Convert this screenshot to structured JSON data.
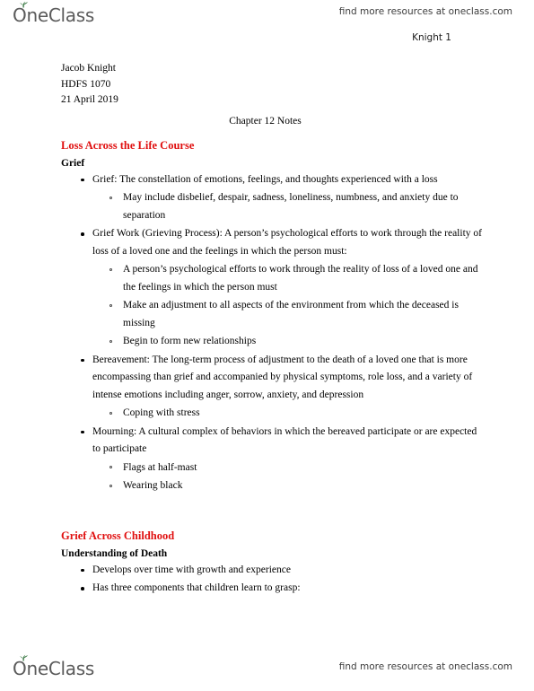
{
  "branding": {
    "logo_text": "OneClass",
    "logo_leaf_icon": "leaf-icon",
    "leaf_color": "#3c7a46",
    "logo_color": "#5b5b5b",
    "watermark": "find more resources at oneclass.com"
  },
  "document": {
    "page_number": "Knight 1",
    "accent_color": "#e01010",
    "meta": [
      "Jacob Knight",
      "HDFS 1070",
      "21 April 2019"
    ],
    "title": "Chapter 12 Notes",
    "sections": [
      {
        "heading": "Loss Across the Life Course",
        "subheading": "Grief",
        "items": [
          {
            "level": 1,
            "text": "Grief: The constellation of emotions, feelings, and thoughts experienced with a loss"
          },
          {
            "level": 2,
            "text": "May include disbelief, despair, sadness, loneliness, numbness, and anxiety due to separation"
          },
          {
            "level": 1,
            "text": "Grief Work (Grieving Process): A person’s psychological efforts to work through the reality of loss of a loved one and the feelings in which the person must:"
          },
          {
            "level": 2,
            "text": "A person’s psychological efforts to work through the reality of loss of a loved one and the feelings in which the person must"
          },
          {
            "level": 2,
            "text": "Make an adjustment to all aspects of the environment from which the deceased is missing"
          },
          {
            "level": 2,
            "text": "Begin to form new relationships"
          },
          {
            "level": 1,
            "text": "Bereavement: The long-term process of adjustment to the death of a loved one that is more encompassing than grief and accompanied by physical symptoms, role loss, and a variety of intense emotions including anger, sorrow, anxiety, and depression"
          },
          {
            "level": 2,
            "text": "Coping with stress"
          },
          {
            "level": 1,
            "text": "Mourning: A cultural complex of behaviors in which the bereaved participate or are expected to participate"
          },
          {
            "level": 2,
            "text": "Flags at half-mast"
          },
          {
            "level": 2,
            "text": "Wearing black"
          }
        ]
      },
      {
        "heading": "Grief Across Childhood",
        "subheading": "Understanding of Death",
        "items": [
          {
            "level": 1,
            "text": "Develops over time with growth and experience"
          },
          {
            "level": 1,
            "text": "Has three components that children learn to grasp:"
          }
        ]
      }
    ]
  }
}
